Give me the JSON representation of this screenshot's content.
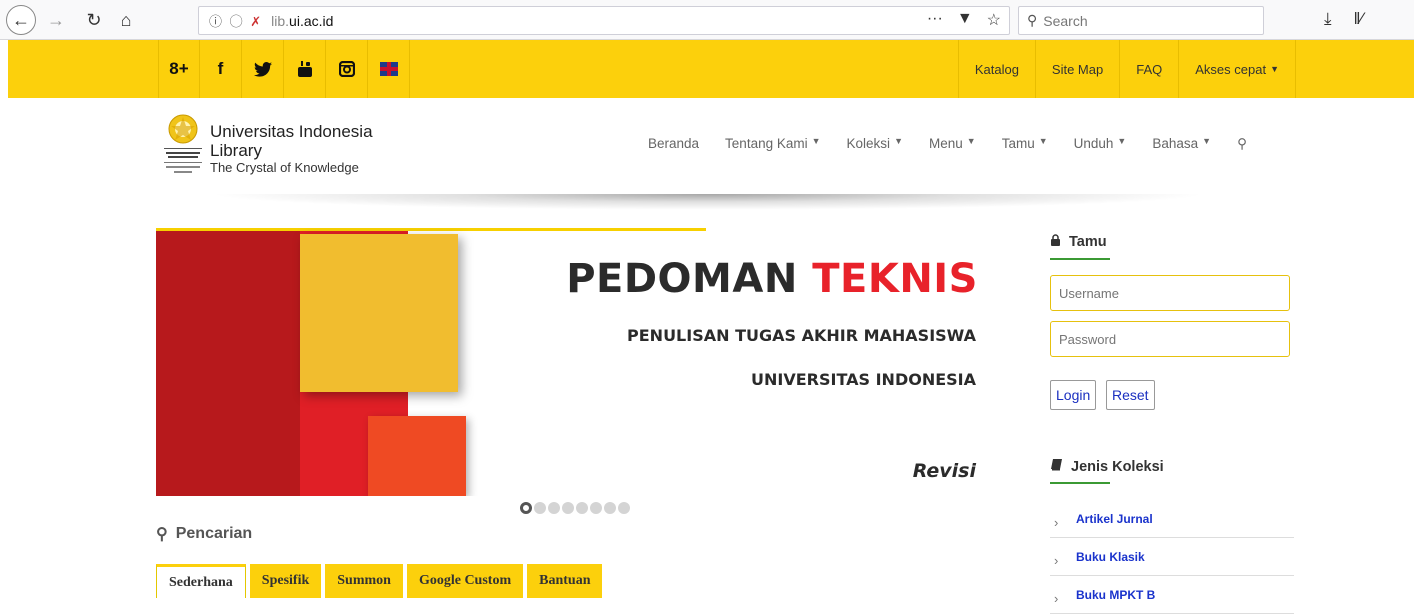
{
  "browser": {
    "url_host": "lib.",
    "url_domain": "ui.ac.id",
    "search_placeholder": "Search"
  },
  "topbar": {
    "social": [
      "8+",
      "f",
      "✦",
      "▶",
      "▣"
    ],
    "links": [
      "Katalog",
      "Site Map",
      "FAQ",
      "Akses cepat"
    ]
  },
  "brand": {
    "title_line1": "Universitas Indonesia",
    "title_line2": "Library",
    "tagline": "The Crystal of Knowledge"
  },
  "nav": {
    "beranda": "Beranda",
    "tentang": "Tentang Kami",
    "koleksi": "Koleksi",
    "menu": "Menu",
    "tamu": "Tamu",
    "unduh": "Unduh",
    "bahasa": "Bahasa"
  },
  "banner": {
    "title_part1": "PEDOMAN ",
    "title_part2": "TEKNIS",
    "subtitle1": "PENULISAN TUGAS AKHIR MAHASISWA",
    "subtitle2": "UNIVERSITAS INDONESIA",
    "revision": "Revisi",
    "slide_count": 8,
    "active_slide": 1
  },
  "search": {
    "heading": "Pencarian",
    "tabs": [
      "Sederhana",
      "Spesifik",
      "Summon",
      "Google Custom",
      "Bantuan"
    ]
  },
  "login": {
    "heading": "Tamu",
    "username_placeholder": "Username",
    "password_placeholder": "Password",
    "login_label": "Login",
    "reset_label": "Reset"
  },
  "collections": {
    "heading": "Jenis Koleksi",
    "items": [
      "Artikel Jurnal",
      "Buku Klasik",
      "Buku MPKT B"
    ]
  },
  "colors": {
    "topbar": "#fcd00c",
    "link_blue": "#1a33cc",
    "accent_green": "#3b9a34",
    "banner_red": "#e8222a"
  }
}
